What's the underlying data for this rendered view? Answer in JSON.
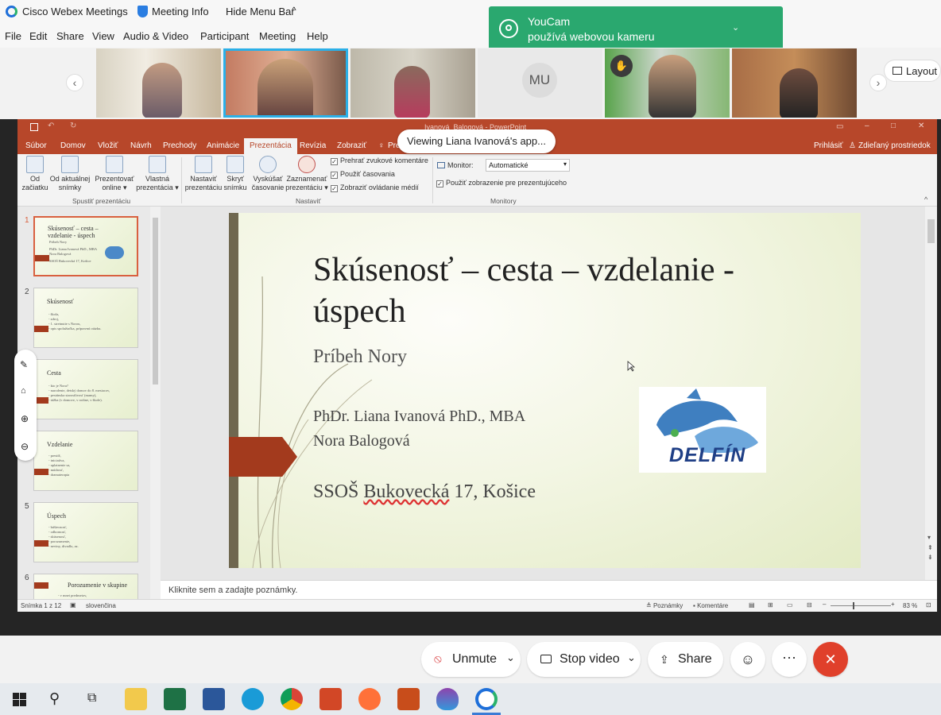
{
  "topbar": {
    "app_name": "Cisco Webex Meetings",
    "meeting_info": "Meeting Info",
    "hide_menu": "Hide Menu Bar"
  },
  "menu": [
    "File",
    "Edit",
    "Share",
    "View",
    "Audio & Video",
    "Participant",
    "Meeting",
    "Help"
  ],
  "toast": {
    "app": "YouCam",
    "message": "používá webovou kameru"
  },
  "strip": {
    "initials": "MU",
    "layout_label": "Layout"
  },
  "share_banner": "Viewing Liana Ivanová's app...",
  "ppt": {
    "window_title": "Ivanová_Balogová - PowerPoint",
    "tabs": [
      "Súbor",
      "Domov",
      "Vložiť",
      "Návrh",
      "Prechody",
      "Animácie",
      "Prezentácia",
      "Revízia",
      "Zobraziť",
      "Pre"
    ],
    "active_tab": "Prezentácia",
    "signin": "Prihlásiť",
    "shared_env": "Zdieľaný prostriedok",
    "ribbon": {
      "buttons": [
        [
          "Od",
          "začiatku"
        ],
        [
          "Od aktuálnej",
          "snímky"
        ],
        [
          "Prezentovať",
          "online"
        ],
        [
          "Vlastná",
          "prezentácia"
        ],
        [
          "Nastaviť",
          "prezentáciu"
        ],
        [
          "Skryť",
          "snímku"
        ],
        [
          "Vyskúšať",
          "časovanie"
        ],
        [
          "Zaznamenať",
          "prezentáciu"
        ]
      ],
      "checks": [
        "Prehrať zvukové komentáre",
        "Použiť časovania",
        "Zobraziť ovládanie médií"
      ],
      "monitor_label": "Monitor:",
      "monitor_value": "Automatické",
      "presenter_view": "Použiť zobrazenie pre prezentujúceho",
      "groups": [
        "Spustiť prezentáciu",
        "Nastaviť",
        "Monitory"
      ]
    },
    "thumbnails": [
      {
        "num": "1",
        "title": "Skúsenosť – cesta – vzdelanie - úspech",
        "lines": [
          "Príbeh Nory",
          "PhDr. Liana Ivanová PhD., MBA",
          "Nora Balogová",
          "SSOŠ Bukovecká 17, Košice"
        ]
      },
      {
        "num": "2",
        "title": "Skúsenosť",
        "lines": [
          "- škola,",
          "- zdroj,",
          "- 1. stretnutie s Norou,",
          "- opis spolužiačka, prípravnú otázku."
        ]
      },
      {
        "num": "3",
        "title": "Cesta",
        "lines": [
          "- kto je Nora?",
          "- narodenie, detský domov do 8. mesiacov,",
          "- pestúnska starostlivosť (mamy),",
          "- túžba (v domove, v rodine, v škole)."
        ]
      },
      {
        "num": "4",
        "title": "Vzdelanie",
        "lines": [
          "- prestíž,",
          "- iniciatíva,",
          "- uplatnenie sa,",
          "- múdrosť,",
          "- dramaterapia"
        ]
      },
      {
        "num": "5",
        "title": "Úspech",
        "lines": [
          "- búšiecnosť,",
          "- odbornosť,",
          "- skúsenosť,",
          "- porozumenie,",
          "- neviny, divadlo, az."
        ]
      },
      {
        "num": "6",
        "title": "Porozumenie v skupine",
        "lines": [
          "- v mnei predmetov,"
        ]
      }
    ],
    "slide": {
      "title": "Skúsenosť – cesta – vzdelanie - úspech",
      "subtitle": "Príbeh Nory",
      "author1": "PhDr. Liana Ivanová PhD., MBA",
      "author2": "Nora Balogová",
      "school_prefix": "SSOŠ ",
      "school_street": "Bukovecká",
      "school_suffix": " 17, Košice",
      "logo_text": "DELFÍN"
    },
    "notes_placeholder": "Kliknite sem a zadajte poznámky.",
    "status": {
      "slide_info": "Snímka 1 z 12",
      "language": "slovenčina",
      "notes": "Poznámky",
      "comments": "Komentáre",
      "zoom": "83 %"
    }
  },
  "controls": {
    "unmute": "Unmute",
    "stop_video": "Stop video",
    "share": "Share"
  },
  "colors": {
    "ppt_red": "#b7472a",
    "webex_green": "#2aa86f",
    "end_red": "#e0402b"
  }
}
